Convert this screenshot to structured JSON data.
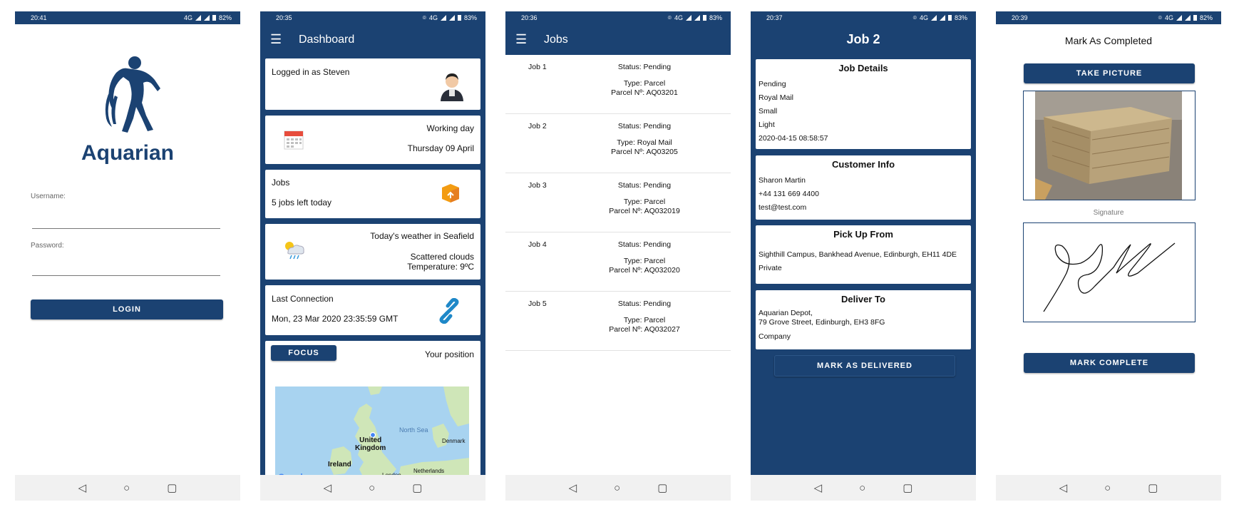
{
  "screens": {
    "login": {
      "status": {
        "time": "20:41",
        "network": "4G",
        "battery": "82%"
      },
      "brand": "Aquarian",
      "username_label": "Username:",
      "password_label": "Password:",
      "login_button": "LOGIN"
    },
    "dashboard": {
      "status": {
        "time": "20:35",
        "network": "4G",
        "battery": "83%"
      },
      "title": "Dashboard",
      "logged_in": "Logged in as Steven",
      "working_day_label": "Working day",
      "working_day_date": "Thursday 09 April",
      "jobs_label": "Jobs",
      "jobs_left": "5 jobs left today",
      "weather_title": "Today's weather in Seafield",
      "weather_desc": "Scattered clouds",
      "weather_temp": "Temperature: 9ºC",
      "last_conn_label": "Last Connection",
      "last_conn_value": "Mon, 23 Mar 2020 23:35:59 GMT",
      "focus_button": "FOCUS",
      "position_label": "Your position",
      "map": {
        "north_sea": "North Sea",
        "uk": "United\nKingdom",
        "ireland": "Ireland",
        "denmark": "Denmark",
        "netherlands": "Netherlands",
        "london": "London",
        "google": "Google"
      }
    },
    "jobs": {
      "status": {
        "time": "20:36",
        "network": "4G",
        "battery": "83%"
      },
      "title": "Jobs",
      "rows": [
        {
          "name": "Job 1",
          "status": "Status: Pending",
          "type": "Type: Parcel",
          "parcel": "Parcel Nº: AQ03201"
        },
        {
          "name": "Job 2",
          "status": "Status: Pending",
          "type": "Type: Royal Mail",
          "parcel": "Parcel Nº: AQ03205"
        },
        {
          "name": "Job 3",
          "status": "Status: Pending",
          "type": "Type: Parcel",
          "parcel": "Parcel Nº: AQ032019"
        },
        {
          "name": "Job 4",
          "status": "Status: Pending",
          "type": "Type: Parcel",
          "parcel": "Parcel Nº: AQ032020"
        },
        {
          "name": "Job 5",
          "status": "Status: Pending",
          "type": "Type: Parcel",
          "parcel": "Parcel Nº: AQ032027"
        }
      ]
    },
    "job_detail": {
      "status": {
        "time": "20:37",
        "network": "4G",
        "battery": "83%"
      },
      "title": "Job 2",
      "job_details_header": "Job Details",
      "job_details": [
        "Pending",
        "Royal Mail",
        "Small",
        "Light",
        "2020-04-15 08:58:57"
      ],
      "customer_header": "Customer Info",
      "customer": [
        "Sharon Martin",
        "+44 131 669 4400",
        "test@test.com"
      ],
      "pickup_header": "Pick Up From",
      "pickup": [
        "Sighthill Campus, Bankhead Avenue, Edinburgh, EH11 4DE",
        "Private"
      ],
      "deliver_header": "Deliver To",
      "deliver": [
        "Aquarian Depot,",
        "79 Grove Street, Edinburgh, EH3 8FG",
        "Company"
      ],
      "mark_delivered_button": "MARK AS DELIVERED"
    },
    "complete": {
      "status": {
        "time": "20:39",
        "network": "4G",
        "battery": "82%"
      },
      "heading": "Mark As Completed",
      "take_picture_button": "TAKE PICTURE",
      "signature_label": "Signature",
      "mark_complete_button": "MARK COMPLETE"
    }
  },
  "colors": {
    "primary": "#1b4272",
    "nav_bg": "#f1f1f1",
    "map_water": "#a8d3f0",
    "map_land": "#cfe6b8"
  },
  "icons": {
    "nav": [
      "back-icon",
      "home-icon",
      "recents-icon"
    ]
  }
}
